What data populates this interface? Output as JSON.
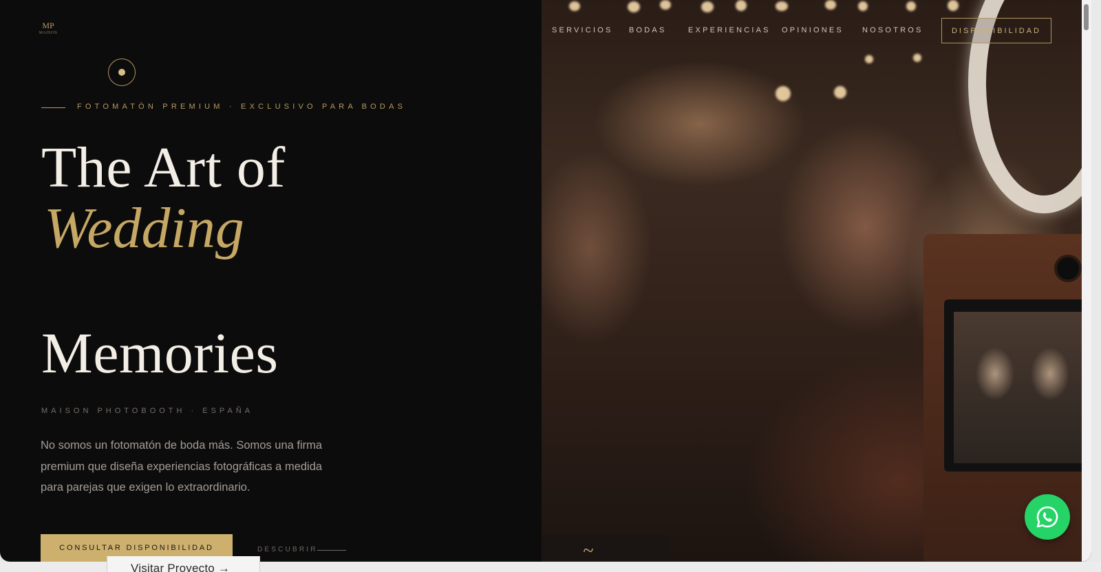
{
  "brand": {
    "logo_monogram": "MP",
    "logo_word": "MAISON"
  },
  "nav": {
    "items": [
      {
        "label": "SERVICIOS"
      },
      {
        "label": "BODAS"
      },
      {
        "label": "EXPERIENCIAS"
      },
      {
        "label": "OPINIONES"
      },
      {
        "label": "NOSOTROS"
      }
    ],
    "cta_label": "DISPONIBILIDAD"
  },
  "hero": {
    "eyebrow": "FOTOMATÓN PREMIUM · EXCLUSIVO PARA BODAS",
    "headline_line1": "The Art of",
    "headline_line2": "Wedding",
    "headline_line3": "Memories",
    "subbrand": "MAISON PHOTOBOOTH · ESPAÑA",
    "description": "No somos un fotomatón de boda más. Somos una firma premium que diseña experiencias fotográficas a medida para parejas que exigen lo extraordinario.",
    "cta_label": "CONSULTAR DISPONIBILIDAD",
    "discover_label": "DESCUBRIR"
  },
  "footer_peek": {
    "link_label": "Visitar Proyecto →"
  },
  "icons": {
    "whatsapp": "whatsapp-icon",
    "circle": "circle-dot-icon"
  },
  "colors": {
    "background": "#0d0c0c",
    "gold": "#c6a865",
    "headline": "#f3eee6",
    "whatsapp": "#25d366"
  }
}
